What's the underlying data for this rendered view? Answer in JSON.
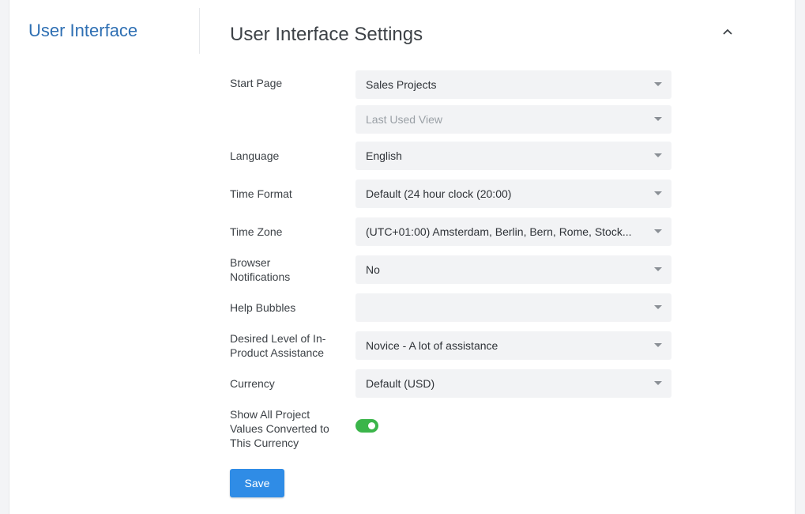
{
  "sidebar": {
    "title": "User Interface"
  },
  "main": {
    "title": "User Interface Settings"
  },
  "fields": {
    "start_page": {
      "label": "Start Page",
      "value": "Sales Projects",
      "secondary_value": "Last Used View"
    },
    "language": {
      "label": "Language",
      "value": "English"
    },
    "time_format": {
      "label": "Time Format",
      "value": "Default (24 hour clock (20:00)"
    },
    "time_zone": {
      "label": "Time Zone",
      "value": "(UTC+01:00) Amsterdam, Berlin, Bern, Rome, Stock..."
    },
    "browser_notifications": {
      "label_line1": "Browser",
      "label_line2": "Notifications",
      "value": "No"
    },
    "help_bubbles": {
      "label": "Help Bubbles",
      "value": ""
    },
    "assistance": {
      "label_line1": "Desired Level of In-",
      "label_line2": "Product Assistance",
      "value": "Novice - A lot of assistance"
    },
    "currency": {
      "label": "Currency",
      "value": "Default (USD)"
    },
    "show_converted": {
      "label_line1": "Show All Project",
      "label_line2": "Values Converted to",
      "label_line3": "This Currency",
      "enabled": true
    }
  },
  "actions": {
    "save_label": "Save"
  },
  "colors": {
    "accent": "#2f8ce6",
    "toggle_on": "#3bb54a",
    "sidebar_title": "#2e6fb3"
  },
  "icons": {
    "collapse": "chevron-up-icon",
    "dropdown": "caret-down-icon"
  }
}
